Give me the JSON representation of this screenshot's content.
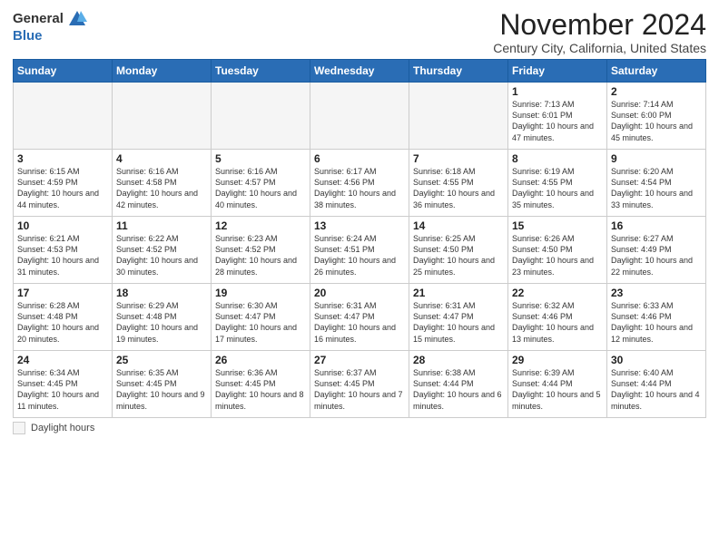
{
  "header": {
    "logo_general": "General",
    "logo_blue": "Blue",
    "month_title": "November 2024",
    "subtitle": "Century City, California, United States"
  },
  "days_of_week": [
    "Sunday",
    "Monday",
    "Tuesday",
    "Wednesday",
    "Thursday",
    "Friday",
    "Saturday"
  ],
  "legend": {
    "label": "Daylight hours"
  },
  "weeks": [
    [
      {
        "num": "",
        "info": ""
      },
      {
        "num": "",
        "info": ""
      },
      {
        "num": "",
        "info": ""
      },
      {
        "num": "",
        "info": ""
      },
      {
        "num": "",
        "info": ""
      },
      {
        "num": "1",
        "info": "Sunrise: 7:13 AM\nSunset: 6:01 PM\nDaylight: 10 hours and 47 minutes."
      },
      {
        "num": "2",
        "info": "Sunrise: 7:14 AM\nSunset: 6:00 PM\nDaylight: 10 hours and 45 minutes."
      }
    ],
    [
      {
        "num": "3",
        "info": "Sunrise: 6:15 AM\nSunset: 4:59 PM\nDaylight: 10 hours and 44 minutes."
      },
      {
        "num": "4",
        "info": "Sunrise: 6:16 AM\nSunset: 4:58 PM\nDaylight: 10 hours and 42 minutes."
      },
      {
        "num": "5",
        "info": "Sunrise: 6:16 AM\nSunset: 4:57 PM\nDaylight: 10 hours and 40 minutes."
      },
      {
        "num": "6",
        "info": "Sunrise: 6:17 AM\nSunset: 4:56 PM\nDaylight: 10 hours and 38 minutes."
      },
      {
        "num": "7",
        "info": "Sunrise: 6:18 AM\nSunset: 4:55 PM\nDaylight: 10 hours and 36 minutes."
      },
      {
        "num": "8",
        "info": "Sunrise: 6:19 AM\nSunset: 4:55 PM\nDaylight: 10 hours and 35 minutes."
      },
      {
        "num": "9",
        "info": "Sunrise: 6:20 AM\nSunset: 4:54 PM\nDaylight: 10 hours and 33 minutes."
      }
    ],
    [
      {
        "num": "10",
        "info": "Sunrise: 6:21 AM\nSunset: 4:53 PM\nDaylight: 10 hours and 31 minutes."
      },
      {
        "num": "11",
        "info": "Sunrise: 6:22 AM\nSunset: 4:52 PM\nDaylight: 10 hours and 30 minutes."
      },
      {
        "num": "12",
        "info": "Sunrise: 6:23 AM\nSunset: 4:52 PM\nDaylight: 10 hours and 28 minutes."
      },
      {
        "num": "13",
        "info": "Sunrise: 6:24 AM\nSunset: 4:51 PM\nDaylight: 10 hours and 26 minutes."
      },
      {
        "num": "14",
        "info": "Sunrise: 6:25 AM\nSunset: 4:50 PM\nDaylight: 10 hours and 25 minutes."
      },
      {
        "num": "15",
        "info": "Sunrise: 6:26 AM\nSunset: 4:50 PM\nDaylight: 10 hours and 23 minutes."
      },
      {
        "num": "16",
        "info": "Sunrise: 6:27 AM\nSunset: 4:49 PM\nDaylight: 10 hours and 22 minutes."
      }
    ],
    [
      {
        "num": "17",
        "info": "Sunrise: 6:28 AM\nSunset: 4:48 PM\nDaylight: 10 hours and 20 minutes."
      },
      {
        "num": "18",
        "info": "Sunrise: 6:29 AM\nSunset: 4:48 PM\nDaylight: 10 hours and 19 minutes."
      },
      {
        "num": "19",
        "info": "Sunrise: 6:30 AM\nSunset: 4:47 PM\nDaylight: 10 hours and 17 minutes."
      },
      {
        "num": "20",
        "info": "Sunrise: 6:31 AM\nSunset: 4:47 PM\nDaylight: 10 hours and 16 minutes."
      },
      {
        "num": "21",
        "info": "Sunrise: 6:31 AM\nSunset: 4:47 PM\nDaylight: 10 hours and 15 minutes."
      },
      {
        "num": "22",
        "info": "Sunrise: 6:32 AM\nSunset: 4:46 PM\nDaylight: 10 hours and 13 minutes."
      },
      {
        "num": "23",
        "info": "Sunrise: 6:33 AM\nSunset: 4:46 PM\nDaylight: 10 hours and 12 minutes."
      }
    ],
    [
      {
        "num": "24",
        "info": "Sunrise: 6:34 AM\nSunset: 4:45 PM\nDaylight: 10 hours and 11 minutes."
      },
      {
        "num": "25",
        "info": "Sunrise: 6:35 AM\nSunset: 4:45 PM\nDaylight: 10 hours and 9 minutes."
      },
      {
        "num": "26",
        "info": "Sunrise: 6:36 AM\nSunset: 4:45 PM\nDaylight: 10 hours and 8 minutes."
      },
      {
        "num": "27",
        "info": "Sunrise: 6:37 AM\nSunset: 4:45 PM\nDaylight: 10 hours and 7 minutes."
      },
      {
        "num": "28",
        "info": "Sunrise: 6:38 AM\nSunset: 4:44 PM\nDaylight: 10 hours and 6 minutes."
      },
      {
        "num": "29",
        "info": "Sunrise: 6:39 AM\nSunset: 4:44 PM\nDaylight: 10 hours and 5 minutes."
      },
      {
        "num": "30",
        "info": "Sunrise: 6:40 AM\nSunset: 4:44 PM\nDaylight: 10 hours and 4 minutes."
      }
    ]
  ]
}
